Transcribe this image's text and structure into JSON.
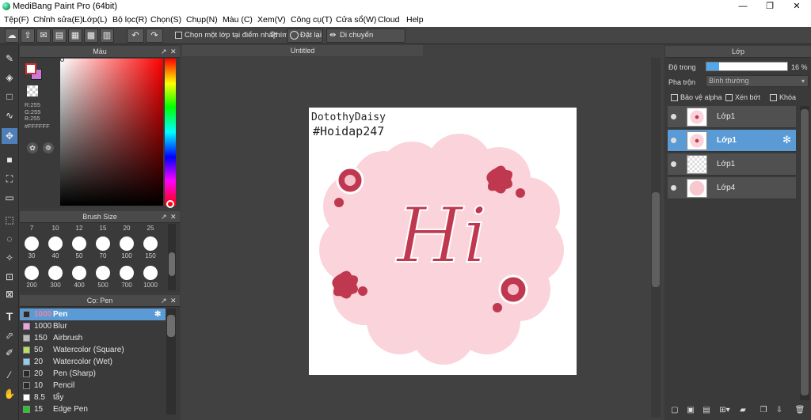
{
  "window": {
    "title": "MediBang Paint Pro (64bit)",
    "min": "—",
    "max": "❐",
    "close": "✕"
  },
  "menu": [
    "Tệp(F)",
    "Chỉnh sửa(E)",
    "Lớp(L)",
    "Bộ lọc(R)",
    "Chọn(S)",
    "Chụp(N)",
    "Màu (C)",
    "Xem(V)",
    "Công cụ(T)",
    "Cửa sổ(W)",
    "Cloud",
    "Help"
  ],
  "toolbar": {
    "snap_label": "Chọn một lớp tại điểm nhấp",
    "phim_label": "Phím",
    "reset_label": "Đặt lại",
    "move_label": "Di chuyển ngang/dọc"
  },
  "color_panel": {
    "title": "Màu",
    "r": "R:255",
    "g": "G:255",
    "b": "B:255",
    "hex": "#FFFFFF",
    "primary": "#ffffff",
    "secondary": "#c87bd8"
  },
  "brush_size": {
    "title": "Brush Size",
    "header": [
      "7",
      "10",
      "12",
      "15",
      "20",
      "25"
    ],
    "row1": [
      "30",
      "40",
      "50",
      "70",
      "100",
      "150"
    ],
    "row2": [
      "200",
      "300",
      "400",
      "500",
      "700",
      "1000"
    ]
  },
  "pen_panel": {
    "title": "Cọ: Pen",
    "items": [
      {
        "size": "1000",
        "name": "Pen",
        "color": "#2a2a2a",
        "selected": true
      },
      {
        "size": "1000",
        "name": "Blur",
        "color": "#f0a0e8"
      },
      {
        "size": "150",
        "name": "Airbrush",
        "color": "#bbbbbb"
      },
      {
        "size": "50",
        "name": "Watercolor (Square)",
        "color": "#b8e060"
      },
      {
        "size": "20",
        "name": "Watercolor (Wet)",
        "color": "#8ecdf0"
      },
      {
        "size": "20",
        "name": "Pen (Sharp)",
        "color": "#2a2a2a"
      },
      {
        "size": "10",
        "name": "Pencil",
        "color": "#2a2a2a"
      },
      {
        "size": "8.5",
        "name": "tẩy",
        "color": "#ffffff"
      },
      {
        "size": "15",
        "name": "Edge Pen",
        "color": "#22cc22"
      }
    ]
  },
  "canvas": {
    "tab_title": "Untitled",
    "line1": "DotothyDaisy",
    "line2": "#Hoidap247",
    "word": "Hi"
  },
  "layer_panel": {
    "title": "Lớp",
    "opacity_label": "Độ trong",
    "opacity_value": "16 %",
    "opacity": 0.16,
    "blend_label": "Pha trộn",
    "blend_value": "Bình thường",
    "alpha_label": "Bảo vệ alpha",
    "clip_label": "Xén bớt",
    "lock_label": "Khóa",
    "layers": [
      {
        "name": "Lớp1",
        "selected": false
      },
      {
        "name": "Lớp1",
        "selected": true
      },
      {
        "name": "Lớp1",
        "selected": false
      },
      {
        "name": "Lớp4",
        "selected": false
      }
    ]
  }
}
